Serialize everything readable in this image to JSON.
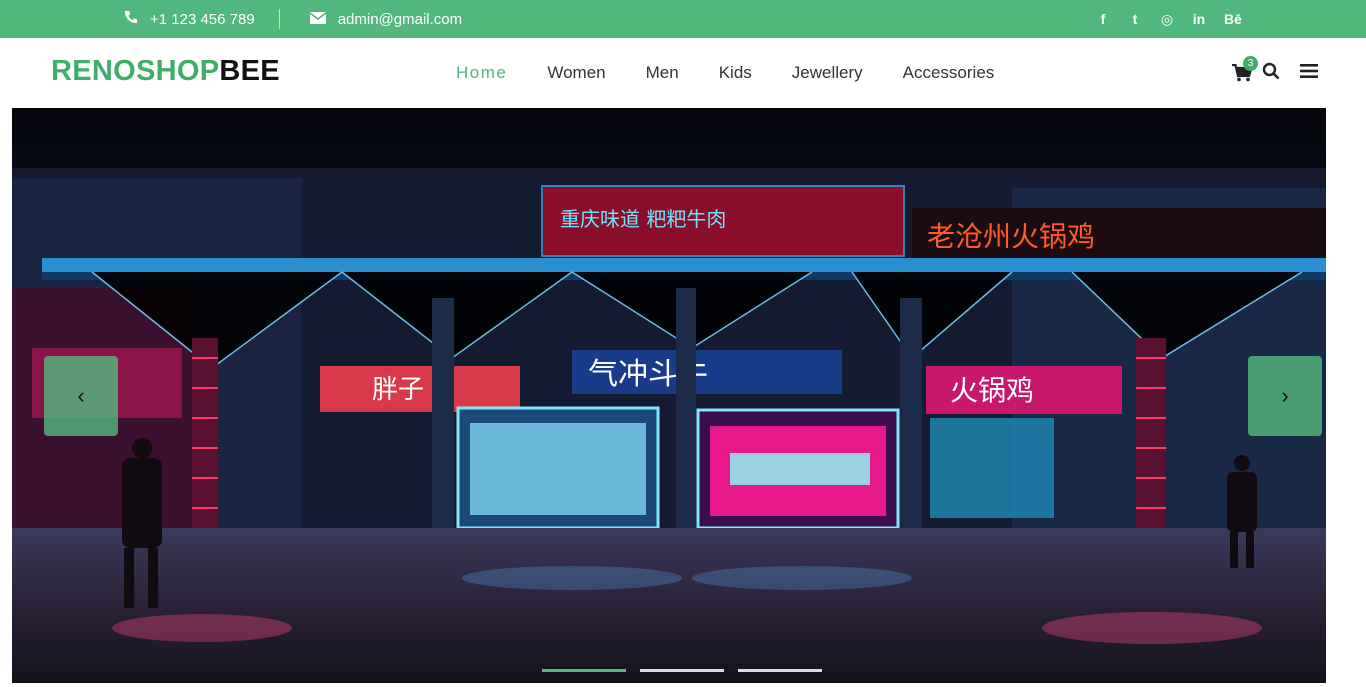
{
  "topbar": {
    "phone": "+1 123 456 789",
    "email": "admin@gmail.com",
    "phone_icon": "phone-icon",
    "email_icon": "envelope-icon",
    "social": [
      {
        "icon": "facebook-icon",
        "glyph": "f"
      },
      {
        "icon": "twitter-icon",
        "glyph": "t"
      },
      {
        "icon": "instagram-icon",
        "glyph": "◎"
      },
      {
        "icon": "linkedin-icon",
        "glyph": "in"
      },
      {
        "icon": "behance-icon",
        "glyph": "Bē"
      }
    ]
  },
  "header": {
    "logo_part1": "RENOSHOP",
    "logo_part2": "BEE",
    "nav": [
      {
        "label": "Home",
        "active": true
      },
      {
        "label": "Women",
        "active": false
      },
      {
        "label": "Men",
        "active": false
      },
      {
        "label": "Kids",
        "active": false
      },
      {
        "label": "Jewellery",
        "active": false
      },
      {
        "label": "Accessories",
        "active": false
      }
    ],
    "cart_count": "3"
  },
  "hero": {
    "prev_label": "‹",
    "next_label": "›",
    "slide_count": 3,
    "active_slide": 1,
    "image_signs": {
      "sign1": "重庆味道  粑粑牛肉",
      "sign2": "老沧州火锅鸡",
      "sign3": "火锅鸡",
      "sign4": "气冲斗牛"
    }
  },
  "colors": {
    "brand": "#52b77d",
    "logo_green": "#3fae6b"
  }
}
